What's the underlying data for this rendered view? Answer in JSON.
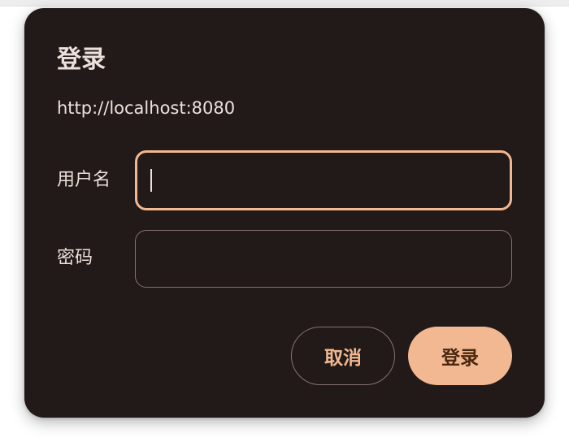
{
  "dialog": {
    "title": "登录",
    "origin": "http://localhost:8080",
    "username": {
      "label": "用户名",
      "value": ""
    },
    "password": {
      "label": "密码",
      "value": ""
    },
    "cancel_label": "取消",
    "login_label": "登录"
  },
  "colors": {
    "dialog_background": "#211a18",
    "accent": "#f2b891",
    "text": "#ede0dc",
    "outline": "#857370"
  }
}
